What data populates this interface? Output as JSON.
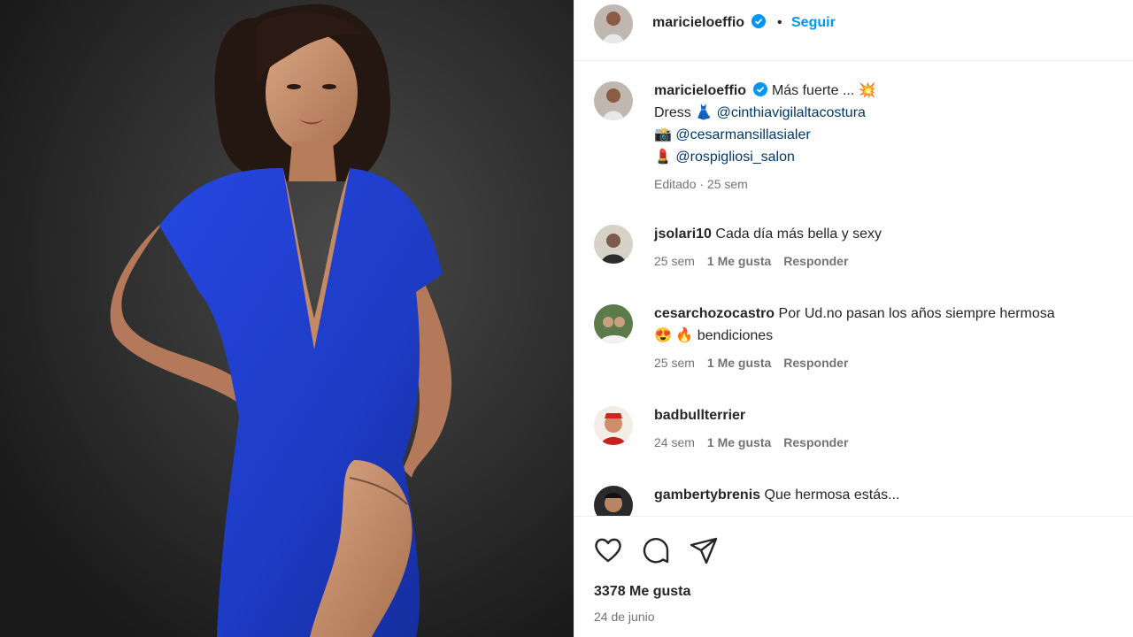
{
  "post": {
    "author": "maricieloeffio",
    "follow_label": "Seguir",
    "separator": "•"
  },
  "caption": {
    "author": "maricieloeffio",
    "line1": "Más fuerte ...",
    "line1_emoji": "💥",
    "line2_prefix": "Dress",
    "line2_emoji": "👗",
    "line2_link": "@cinthiavigilaltacostura",
    "line3_emoji": "📸",
    "line3_link": "@cesarmansillasialer",
    "line4_emoji": "💄",
    "line4_link": "@rospigliosi_salon",
    "meta": "Editado · 25 sem"
  },
  "comments": [
    {
      "user": "jsolari10",
      "text": "Cada día más bella y sexy",
      "time": "25 sem",
      "likes": "1 Me gusta",
      "reply": "Responder"
    },
    {
      "user": "cesarchozocastro",
      "text": "Por Ud.no pasan los años siempre hermosa",
      "text2_emoji": "😍 🔥",
      "text2": "bendiciones",
      "time": "25 sem",
      "likes": "1 Me gusta",
      "reply": "Responder"
    },
    {
      "user": "badbullterrier",
      "text": "",
      "time": "24 sem",
      "likes": "1 Me gusta",
      "reply": "Responder"
    },
    {
      "user": "gambertybrenis",
      "text": "Que hermosa estás..."
    }
  ],
  "footer": {
    "likes": "3378 Me gusta",
    "date": "24 de junio"
  },
  "colors": {
    "accent": "#0095f6",
    "dress": "#1e3fc7",
    "verified": "#0095f6"
  },
  "icons": [
    "heart-icon",
    "comment-icon",
    "share-icon",
    "verified-icon"
  ]
}
